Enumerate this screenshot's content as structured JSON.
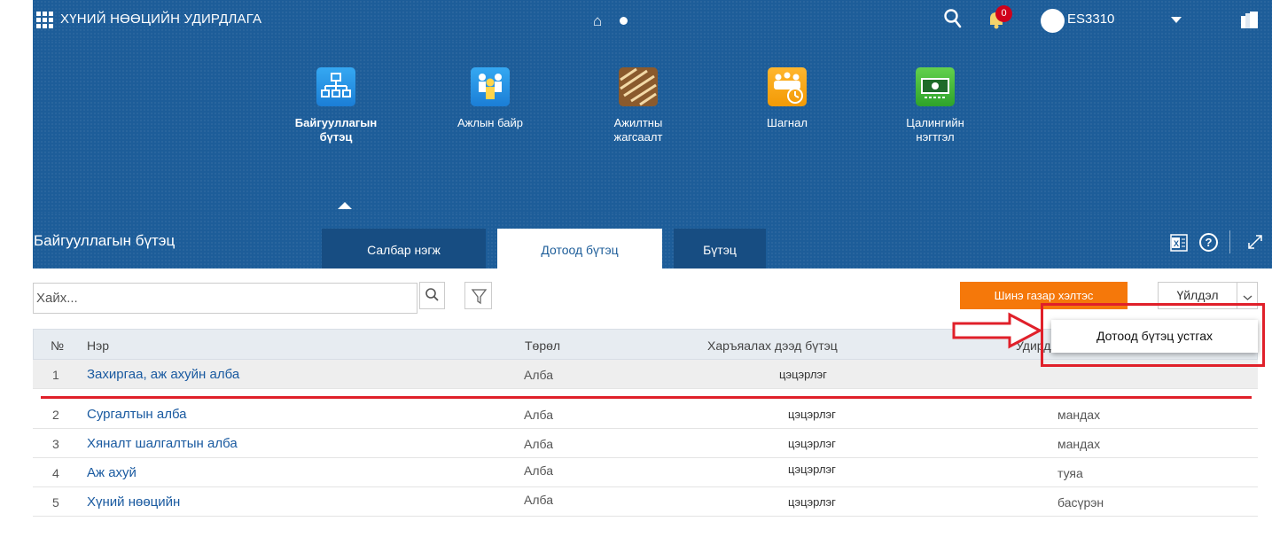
{
  "header": {
    "app_title": "ХҮНИЙ НӨӨЦИЙН УДИРДЛАГА",
    "notification_count": "0",
    "user_name": "ES3310"
  },
  "modules": [
    {
      "label": "Байгууллагын бүтэц",
      "icon": "org-chart-icon",
      "active": true
    },
    {
      "label": "Ажлын байр",
      "icon": "people-group-icon",
      "active": false
    },
    {
      "label": "Ажилтны жагсаалт",
      "icon": "employee-list-icon",
      "active": false
    },
    {
      "label": "Шагнал",
      "icon": "award-clock-icon",
      "active": false
    },
    {
      "label": "Цалингийн нэгтгэл",
      "icon": "money-icon",
      "active": false
    }
  ],
  "panel": {
    "title": "Байгууллагын бүтэц",
    "tabs": [
      {
        "label": "Салбар нэгж",
        "active": false
      },
      {
        "label": "Дотоод бүтэц",
        "active": true
      },
      {
        "label": "Бүтэц",
        "active": false
      }
    ],
    "help_symbol": "?"
  },
  "toolbar": {
    "search_placeholder": "Хайх...",
    "new_button": "Шинэ газар хэлтэс",
    "action_button": "Үйлдэл",
    "dropdown_item": "Дотоод бүтэц устгах"
  },
  "table": {
    "columns": [
      "№",
      "Нэр",
      "Төрөл",
      "Харъяалах дээд бүтэц",
      "Удирдлага"
    ],
    "rows": [
      {
        "no": "1",
        "name": "Захиргаа, аж ахуйн алба",
        "type": "Алба",
        "parent": "цэцэрлэг",
        "manager": ""
      },
      {
        "no": "2",
        "name": "Сургалтын алба",
        "type": "Алба",
        "parent": "цэцэрлэг",
        "manager": "мандах"
      },
      {
        "no": "3",
        "name": "Хяналт шалгалтын алба",
        "type": "Алба",
        "parent": "цэцэрлэг",
        "manager": "мандах"
      },
      {
        "no": "4",
        "name": "Аж ахуй",
        "type": "Алба",
        "parent": "цэцэрлэг",
        "manager": "туяа"
      },
      {
        "no": "5",
        "name": "Хүний нөөцийн",
        "type": "Алба",
        "parent": "цэцэрлэг",
        "manager": "басүрэн"
      }
    ]
  },
  "colors": {
    "primary": "#1d5d99",
    "accent": "#f5780a",
    "annotation": "#e0202a",
    "link": "#1a5aa0"
  }
}
